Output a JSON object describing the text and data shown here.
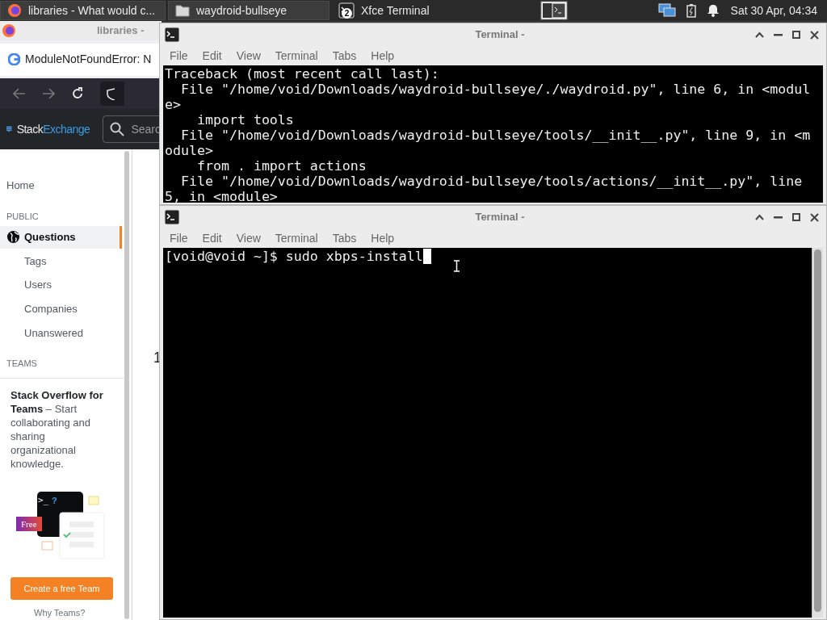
{
  "taskbar": {
    "tasks": [
      {
        "label": "libraries - What would c...",
        "kind": "browser",
        "selected": false
      },
      {
        "label": "waydroid-bullseye",
        "kind": "folder",
        "selected": false
      },
      {
        "label": "Xfce Terminal",
        "kind": "terminal",
        "badge": "2",
        "selected": true
      }
    ],
    "clock": "Sat 30 Apr, 04:34"
  },
  "browser": {
    "title": "libraries -",
    "tab_title": "ModuleNotFoundError: N",
    "logo": {
      "left": "Stack",
      "right": "Exchange"
    },
    "search_placeholder": "Searc",
    "sidebar": [
      {
        "kind": "link",
        "label": "Home",
        "selected": false
      },
      {
        "kind": "heading",
        "label": "PUBLIC"
      },
      {
        "kind": "link",
        "label": "Questions",
        "selected": true
      },
      {
        "kind": "sublink",
        "label": "Tags",
        "selected": false
      },
      {
        "kind": "sublink",
        "label": "Users",
        "selected": false
      },
      {
        "kind": "sublink",
        "label": "Companies",
        "selected": false
      },
      {
        "kind": "sublink",
        "label": "Unanswered",
        "selected": false
      },
      {
        "kind": "heading",
        "label": "TEAMS"
      }
    ],
    "teams_promo": {
      "text": "**Stack Overflow for Teams** – Start collaborating and sharing organizational knowledge.",
      "prompt": ">_",
      "prompt_mark": "?",
      "badge": "Free",
      "button": "Create a free Team",
      "link": "Why Teams?"
    },
    "content_fragment": "1"
  },
  "terminals": [
    {
      "title": "Terminal -",
      "menu": [
        "File",
        "Edit",
        "View",
        "Terminal",
        "Tabs",
        "Help"
      ],
      "lines": [
        "Traceback (most recent call last):",
        "  File \"/home/void/Downloads/waydroid-bullseye/./waydroid.py\", line 6, in <modul",
        "e>",
        "    import tools",
        "  File \"/home/void/Downloads/waydroid-bullseye/tools/__init__.py\", line 9, in <m",
        "odule>",
        "    from . import actions",
        "  File \"/home/void/Downloads/waydroid-bullseye/tools/actions/__init__.py\", line",
        "5, in <module>"
      ],
      "cursor": false
    },
    {
      "title": "Terminal -",
      "menu": [
        "File",
        "Edit",
        "View",
        "Terminal",
        "Tabs",
        "Help"
      ],
      "lines": [
        "[void@void ~]$ sudo xbps-install"
      ],
      "cursor": true
    }
  ]
}
